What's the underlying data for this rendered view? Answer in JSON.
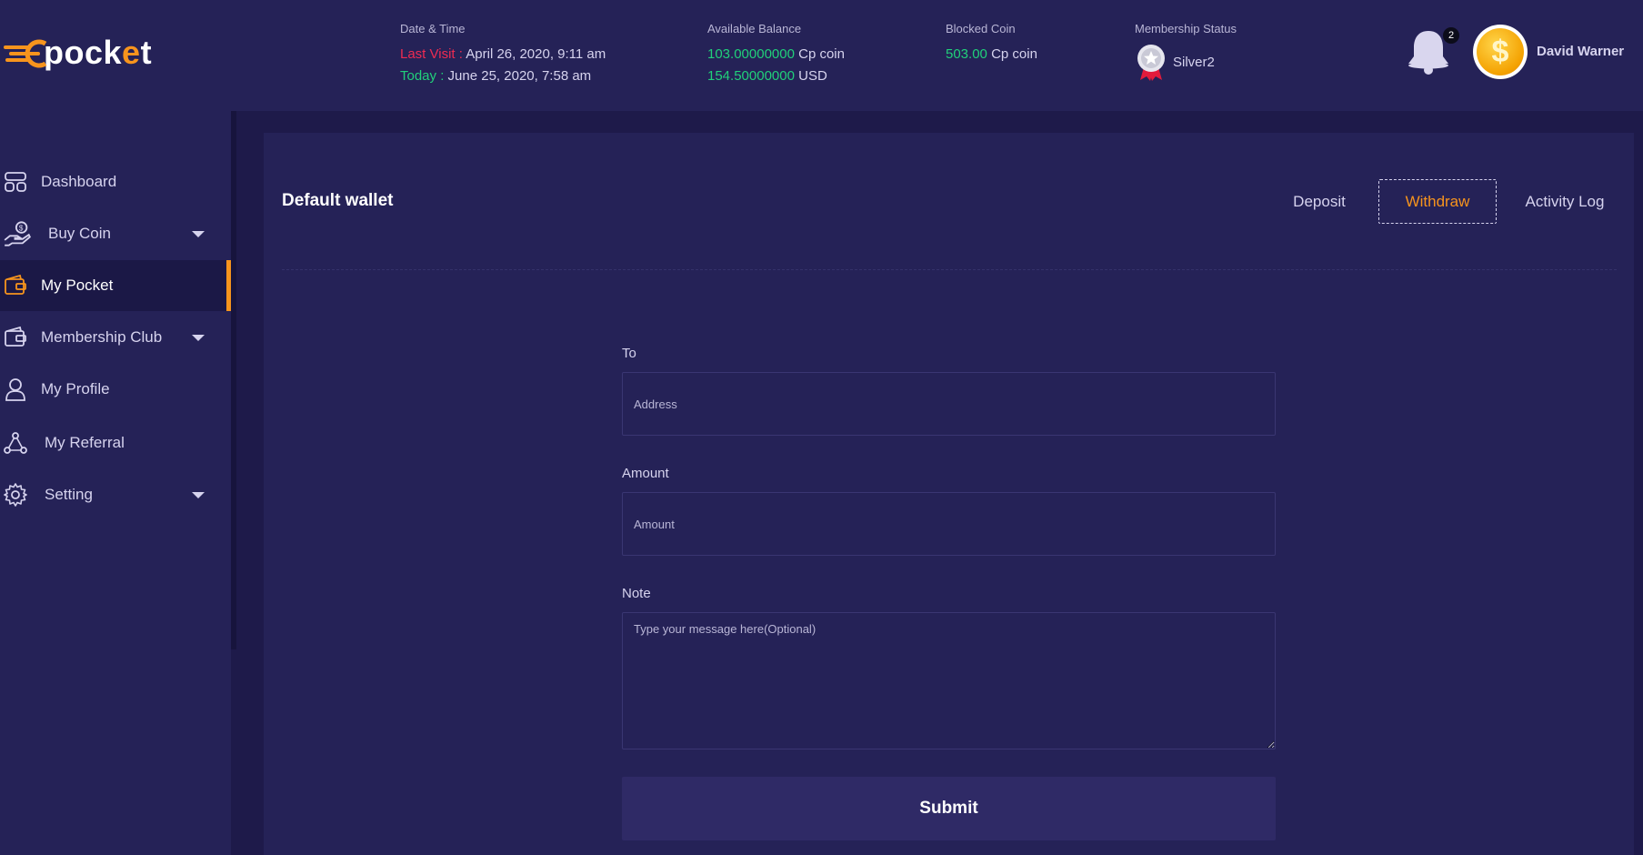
{
  "brand": {
    "name": "pocket",
    "prefix": "c"
  },
  "header": {
    "datetime": {
      "label": "Date & Time",
      "last_visit_label": "Last Visit :",
      "last_visit_value": "April 26, 2020, 9:11 am",
      "today_label": "Today :",
      "today_value": "June 25, 2020, 7:58 am"
    },
    "balance": {
      "label": "Available Balance",
      "coin_amount": "103.00000000",
      "coin_unit": "Cp coin",
      "usd_amount": "154.50000000",
      "usd_unit": "USD"
    },
    "blocked": {
      "label": "Blocked Coin",
      "amount": "503.00",
      "unit": "Cp coin"
    },
    "membership": {
      "label": "Membership Status",
      "level": "Silver2"
    },
    "notifications": {
      "count": "2"
    },
    "user": {
      "name": "David Warner",
      "avatar_symbol": "$"
    }
  },
  "sidebar": {
    "items": [
      {
        "label": "Dashboard",
        "icon": "dashboard-icon"
      },
      {
        "label": "Buy Coin",
        "icon": "buy-coin-icon",
        "has_submenu": true
      },
      {
        "label": "My Pocket",
        "icon": "wallet-icon",
        "active": true
      },
      {
        "label": "Membership Club",
        "icon": "wallet-icon",
        "has_submenu": true
      },
      {
        "label": "My Profile",
        "icon": "user-icon"
      },
      {
        "label": "My Referral",
        "icon": "referral-icon"
      },
      {
        "label": "Setting",
        "icon": "gear-icon",
        "has_submenu": true
      }
    ]
  },
  "wallet": {
    "title": "Default wallet",
    "tabs": [
      {
        "label": "Deposit"
      },
      {
        "label": "Withdraw",
        "active": true
      },
      {
        "label": "Activity Log"
      }
    ],
    "form": {
      "to_label": "To",
      "to_placeholder": "Address",
      "amount_label": "Amount",
      "amount_placeholder": "Amount",
      "note_label": "Note",
      "note_placeholder": "Type your message here(Optional)",
      "submit_label": "Submit"
    }
  },
  "colors": {
    "accent": "#f7941d",
    "positive": "#21d07a",
    "alert": "#ee2b52",
    "background": "#1e1a4a",
    "panel": "#252257"
  }
}
